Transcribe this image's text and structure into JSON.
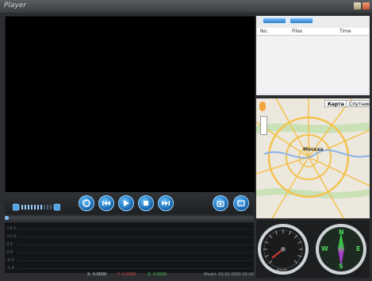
{
  "window": {
    "title": "Player"
  },
  "file_list": {
    "columns": [
      "No.",
      "Files",
      "Time"
    ]
  },
  "map": {
    "tab_map": "Карта",
    "tab_satellite": "Спутник",
    "city_label": "Москва"
  },
  "controls": {
    "buttons": [
      "open",
      "previous",
      "play",
      "stop",
      "next",
      "screenshot",
      "settings"
    ],
    "volume_level": 0.7,
    "seek_progress": 0.015
  },
  "graph": {
    "y_labels": [
      "+0.5",
      "+1.0",
      "0.5",
      "0.0",
      "-0.5",
      "-1.0"
    ],
    "readouts": {
      "x": "X: 0.0000",
      "y": "Y: 0.0000",
      "z": "Z: 0.0000",
      "model": "Model: 00.00.0000 00:00"
    }
  },
  "gauges": {
    "speed_unit": "Km/h",
    "compass_labels": [
      "N",
      "E",
      "S",
      "W"
    ]
  },
  "colors": {
    "accent_blue": "#2c79c4",
    "graph_x": "#d8dde2",
    "graph_y": "#e24a4a",
    "graph_z": "#49c24f"
  }
}
